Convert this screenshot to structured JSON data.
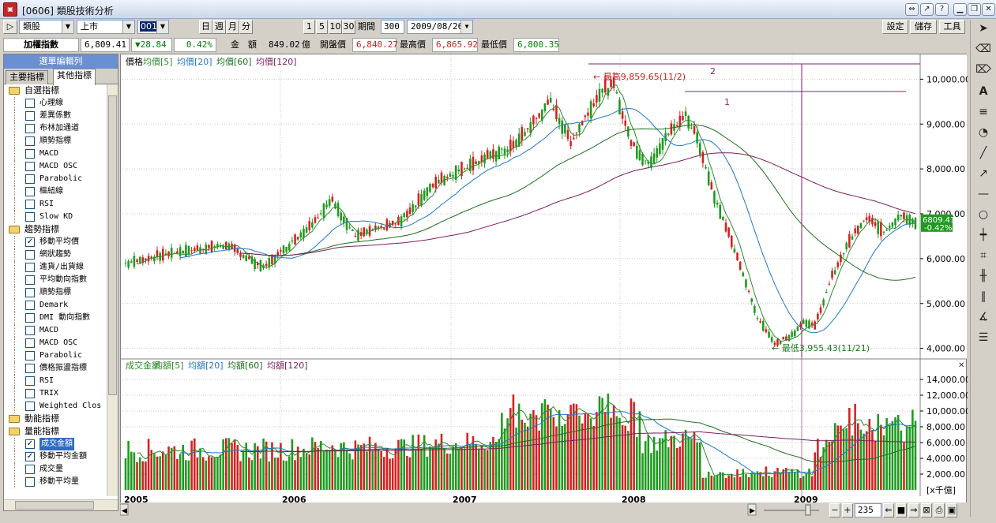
{
  "window": {
    "title": "[0606] 類股技術分析",
    "icon_name": "app-logo-icon"
  },
  "toolbar": {
    "category_select": "類股",
    "market_select": "上市",
    "code_select": "001",
    "period_buttons": [
      "日",
      "週",
      "月",
      "分"
    ],
    "interval_buttons": [
      "1",
      "5",
      "10",
      "30"
    ],
    "period_label": "期間",
    "period_value": "300",
    "date_value": "2009/08/26",
    "settings_label": "設定",
    "save_label": "儲存",
    "tools_label": "工具"
  },
  "quote": {
    "name": "加權指數",
    "last": "6,809.41",
    "change": "▼28.84",
    "change_pct": "0.42%",
    "amount_label": "金　額",
    "amount_value": "849.02",
    "amount_unit": "億",
    "open_label": "開盤價",
    "open_value": "6,840.27",
    "high_label": "最高價",
    "high_value": "6,865.92",
    "low_label": "最低價",
    "low_value": "6,800.35"
  },
  "left_panel": {
    "title": "選單編輯列",
    "tabs": [
      "主要指標",
      "其他指標"
    ],
    "tree": [
      {
        "type": "folder",
        "label": "自選指標"
      },
      {
        "type": "item",
        "label": "心理線",
        "checked": false
      },
      {
        "type": "item",
        "label": "差異係數",
        "checked": false
      },
      {
        "type": "item",
        "label": "布林加通道",
        "checked": false
      },
      {
        "type": "item",
        "label": "順勢指標",
        "checked": false
      },
      {
        "type": "item",
        "label": "MACD",
        "checked": false
      },
      {
        "type": "item",
        "label": "MACD OSC",
        "checked": false
      },
      {
        "type": "item",
        "label": "Parabolic",
        "checked": false
      },
      {
        "type": "item",
        "label": "樞紐線",
        "checked": false
      },
      {
        "type": "item",
        "label": "RSI",
        "checked": false
      },
      {
        "type": "item",
        "label": "Slow KD",
        "checked": false
      },
      {
        "type": "folder",
        "label": "趨勢指標"
      },
      {
        "type": "item",
        "label": "移動平均價",
        "checked": true
      },
      {
        "type": "item",
        "label": "網狀趨勢",
        "checked": false
      },
      {
        "type": "item",
        "label": "進貨/出貨線",
        "checked": false
      },
      {
        "type": "item",
        "label": "平均動向指數",
        "checked": false
      },
      {
        "type": "item",
        "label": "順勢指標",
        "checked": false
      },
      {
        "type": "item",
        "label": "Demark",
        "checked": false
      },
      {
        "type": "item",
        "label": "DMI 動向指數",
        "checked": false
      },
      {
        "type": "item",
        "label": "MACD",
        "checked": false
      },
      {
        "type": "item",
        "label": "MACD OSC",
        "checked": false
      },
      {
        "type": "item",
        "label": "Parabolic",
        "checked": false
      },
      {
        "type": "item",
        "label": "價格振盪指標",
        "checked": false
      },
      {
        "type": "item",
        "label": "RSI",
        "checked": false
      },
      {
        "type": "item",
        "label": "TRIX",
        "checked": false
      },
      {
        "type": "item",
        "label": "Weighted Clos",
        "checked": false
      },
      {
        "type": "folder",
        "label": "動能指標"
      },
      {
        "type": "folder",
        "label": "量能指標"
      },
      {
        "type": "item",
        "label": "成交金額",
        "checked": true,
        "selected": true
      },
      {
        "type": "item",
        "label": "移動平均金額",
        "checked": true
      },
      {
        "type": "item",
        "label": "成交量",
        "checked": false
      },
      {
        "type": "item",
        "label": "移動平均量",
        "checked": false
      }
    ]
  },
  "price_panel": {
    "legend": [
      {
        "label": "價格",
        "color": "#000000"
      },
      {
        "label": "均價[5]",
        "color": "#2e8b2e"
      },
      {
        "label": "均價[20]",
        "color": "#1e78c8"
      },
      {
        "label": "均價[60]",
        "color": "#1e6e1e"
      },
      {
        "label": "均價[120]",
        "color": "#7a1f5a"
      }
    ],
    "y_ticks": [
      "10,000.00",
      "9,000.00",
      "8,000.00",
      "7,000.00",
      "6,000.00",
      "5,000.00",
      "4,000.00"
    ],
    "high_annotation": "最高9,859.65(11/2)",
    "low_annotation": "最低3,955.43(11/21)",
    "last_badge": "6809.41",
    "last_badge_pct": "-0.42%",
    "line_label_1": "1",
    "line_label_2": "2"
  },
  "volume_panel": {
    "legend": [
      {
        "label": "成交金額",
        "color": "#2e8b2e"
      },
      {
        "label": "均額[5]",
        "color": "#2e8b2e"
      },
      {
        "label": "均額[20]",
        "color": "#1e78c8"
      },
      {
        "label": "均額[60]",
        "color": "#1e6e1e"
      },
      {
        "label": "均額[120]",
        "color": "#7a1f5a"
      }
    ],
    "y_ticks": [
      "14,000.00",
      "12,000.00",
      "10,000.00",
      "8,000.00",
      "6,000.00",
      "4,000.00",
      "2,000.00"
    ],
    "unit": "[x千億]"
  },
  "x_axis": {
    "labels": [
      "2005",
      "2006",
      "2007",
      "2008",
      "2009"
    ]
  },
  "bottom": {
    "zoom_value": "235"
  },
  "colors": {
    "up": "#d42020",
    "down": "#1e9a1e",
    "grid": "#c8c8c8",
    "accent": "#6b8fd3"
  },
  "chart_data": {
    "type": "line",
    "title": "",
    "series_note": "TAIEX weighted index, weekly",
    "x": [
      "2005",
      "2006",
      "2007",
      "2008",
      "2009"
    ],
    "price_ylim": [
      3800,
      10200
    ],
    "price_approx": [
      {
        "x": "2005",
        "y": 5900
      },
      {
        "x": "2006",
        "y": 6300
      },
      {
        "x": "2006-05",
        "y": 7200
      },
      {
        "x": "2007",
        "y": 7800
      },
      {
        "x": "2007-07",
        "y": 9700
      },
      {
        "x": "2007-11",
        "y": 9859.65
      },
      {
        "x": "2008",
        "y": 8400
      },
      {
        "x": "2008-05",
        "y": 9100
      },
      {
        "x": "2008-11",
        "y": 3955.43
      },
      {
        "x": "2009",
        "y": 4500
      },
      {
        "x": "2009-06",
        "y": 6900
      },
      {
        "x": "2009-08",
        "y": 6809.41
      }
    ],
    "volume_ylim": [
      0,
      15000
    ]
  }
}
